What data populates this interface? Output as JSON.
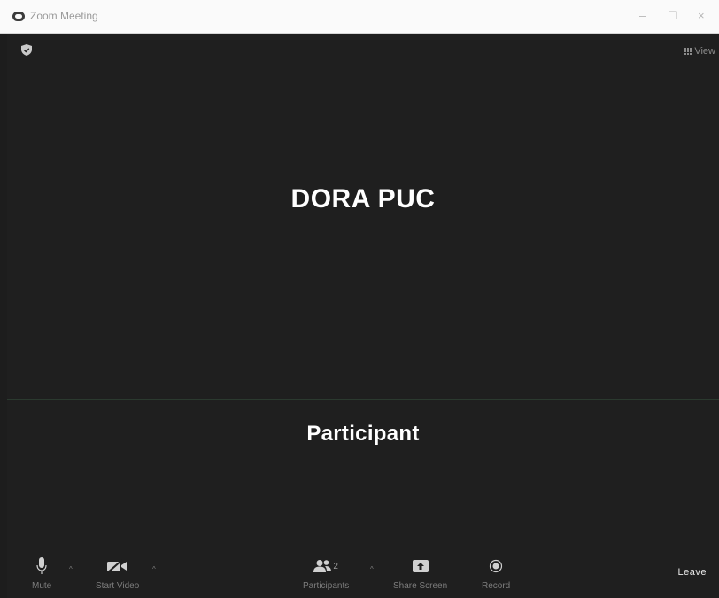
{
  "window": {
    "title": "Zoom Meeting",
    "minimize": "–",
    "maximize": "☐",
    "close": "×"
  },
  "top_bar": {
    "view_label": "View"
  },
  "video": {
    "speaker_name": "DORA PUC",
    "participant_name": "Participant"
  },
  "toolbar": {
    "mute_label": "Mute",
    "start_video_label": "Start Video",
    "participants_label": "Participants",
    "participants_count": "2",
    "share_screen_label": "Share Screen",
    "record_label": "Record",
    "leave_label": "Leave"
  },
  "colors": {
    "background": "#1f1f1f",
    "name_text": "#ffffff",
    "toolbar_text": "#7d7d7d"
  }
}
